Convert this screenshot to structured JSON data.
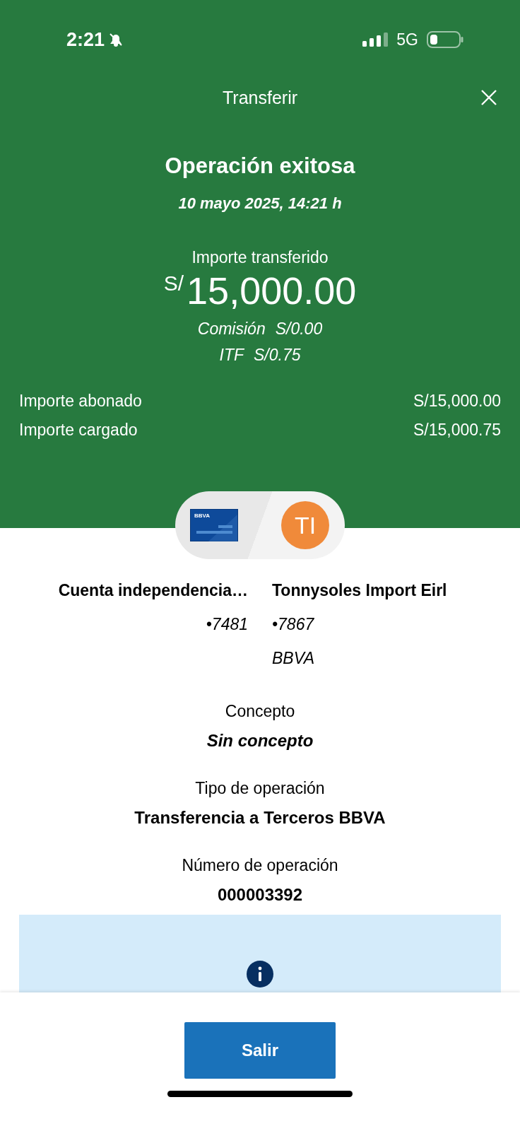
{
  "status_bar": {
    "time": "2:21",
    "network": "5G"
  },
  "header": {
    "title": "Transferir"
  },
  "result": {
    "title": "Operación exitosa",
    "date": "10 mayo 2025, 14:21 h",
    "amount_label": "Importe transferido",
    "currency": "S/",
    "amount": "15,000.00",
    "fees": [
      {
        "label": "Comisión",
        "value": "S/0.00"
      },
      {
        "label": "ITF",
        "value": "S/0.75"
      }
    ]
  },
  "totals": [
    {
      "label": "Importe abonado",
      "value": "S/15,000.00"
    },
    {
      "label": "Importe cargado",
      "value": "S/15,000.75"
    }
  ],
  "parties": {
    "card_logo": "BBVA",
    "initials": "TI",
    "origin": {
      "name": "Cuenta independencia…",
      "account": "•7481"
    },
    "destination": {
      "name": "Tonnysoles Import Eirl",
      "account": "•7867",
      "bank": "BBVA"
    }
  },
  "details": [
    {
      "label": "Concepto",
      "value": "Sin concepto",
      "kind": "italic"
    },
    {
      "label": "Tipo de operación",
      "value": "Transferencia a Terceros BBVA",
      "kind": "plain"
    },
    {
      "label": "Número de operación",
      "value": "000003392",
      "kind": "plain"
    }
  ],
  "footer": {
    "button": "Salir"
  }
}
